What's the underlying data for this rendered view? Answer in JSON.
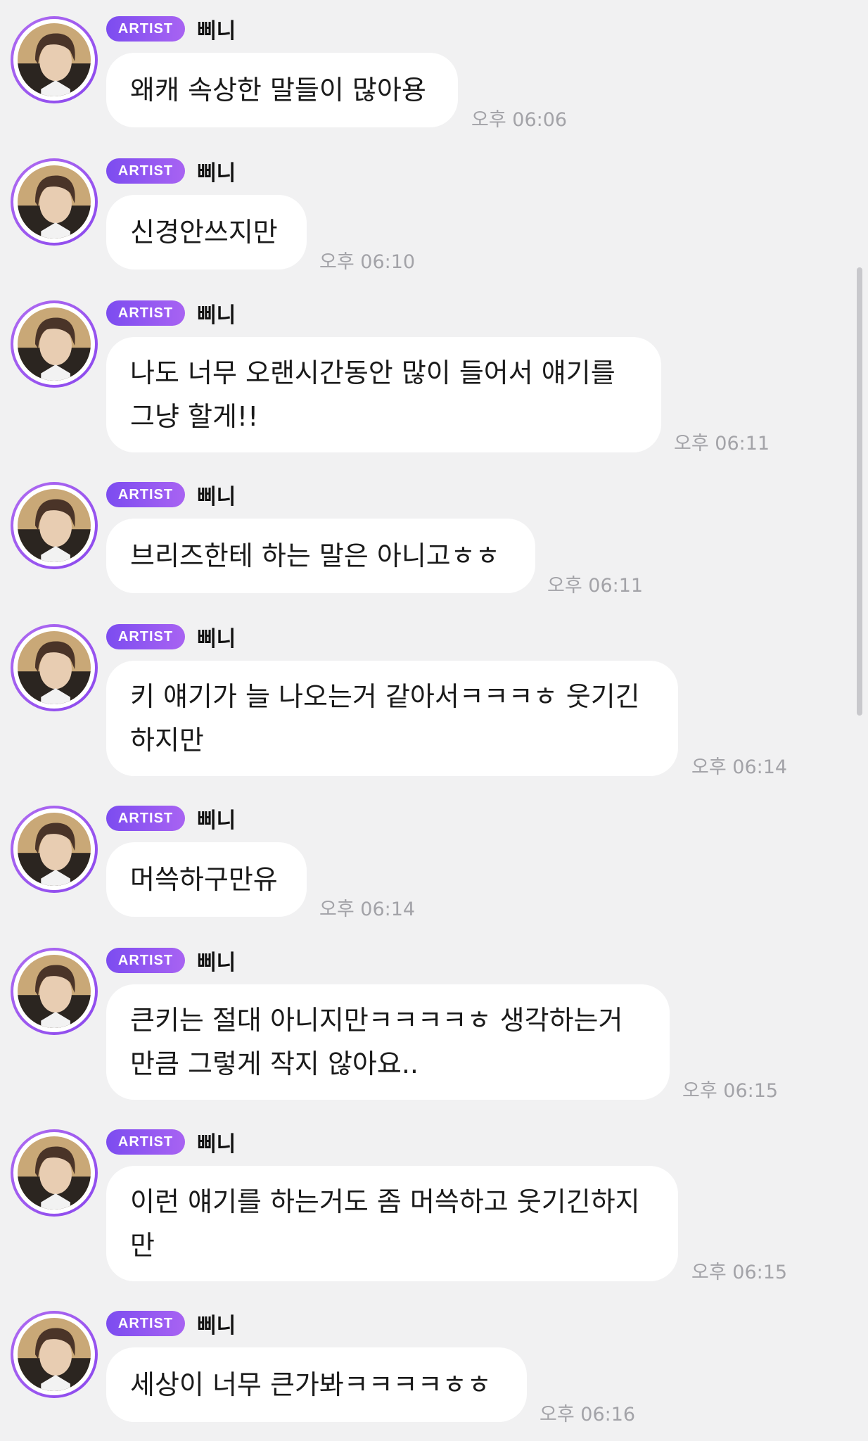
{
  "badge_label": "ARTIST",
  "sender_name": "삐니",
  "messages": [
    {
      "lines": [
        "왜캐 속상한 말들이 많아용"
      ],
      "time": "오후 06:06"
    },
    {
      "lines": [
        "신경안쓰지만"
      ],
      "time": "오후 06:10"
    },
    {
      "lines": [
        "나도 너무 오랜시간동안 많이 들어서 얘기를",
        "그냥 할게!!"
      ],
      "time": "오후 06:11"
    },
    {
      "lines": [
        "브리즈한테 하는 말은 아니고ㅎㅎ"
      ],
      "time": "오후 06:11"
    },
    {
      "lines": [
        "키 얘기가 늘 나오는거 같아서ㅋㅋㅋㅎ 웃기긴",
        "하지만"
      ],
      "time": "오후 06:14"
    },
    {
      "lines": [
        "머쓱하구만유"
      ],
      "time": "오후 06:14"
    },
    {
      "lines": [
        "큰키는 절대 아니지만ㅋㅋㅋㅋㅎ 생각하는거",
        "만큼 그렇게 작지 않아요.."
      ],
      "time": "오후 06:15"
    },
    {
      "lines": [
        "이런 얘기를 하는거도 좀 머쓱하고 웃기긴하지",
        "만"
      ],
      "time": "오후 06:15"
    },
    {
      "lines": [
        "세상이 너무 큰가봐ㅋㅋㅋㅋㅎㅎ"
      ],
      "time": "오후 06:16"
    }
  ],
  "colors": {
    "background": "#f1f1f2",
    "badge_start": "#7c4cf0",
    "badge_end": "#a863f2",
    "bubble": "#ffffff",
    "time_text": "#a3a3a8"
  },
  "icons": {
    "avatar": "profile-photo"
  }
}
